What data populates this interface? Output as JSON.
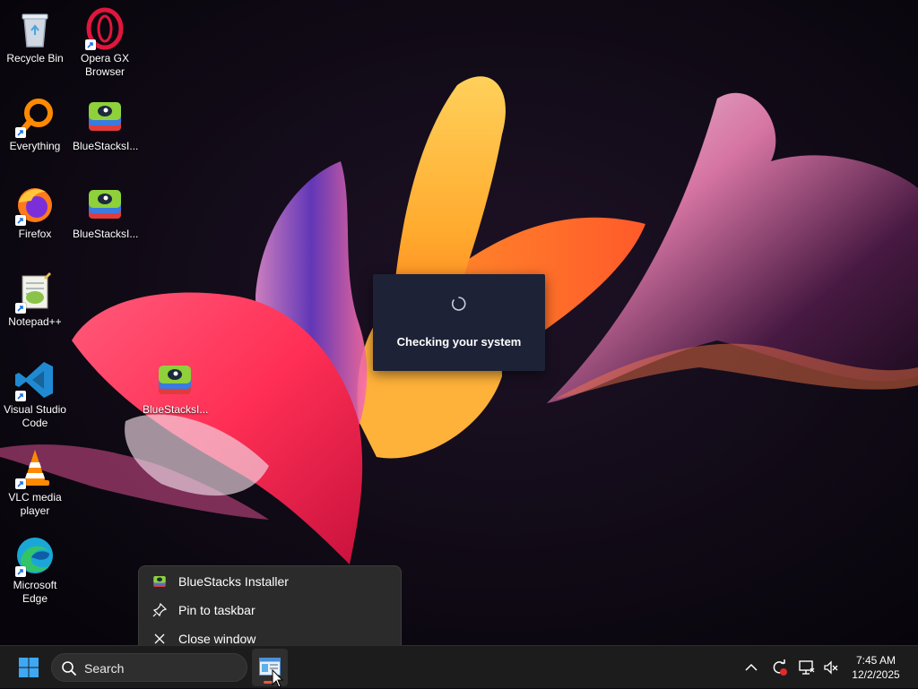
{
  "desktop": {
    "icons": [
      {
        "label": "Recycle Bin"
      },
      {
        "label": "Opera GX Browser"
      },
      {
        "label": "Everything"
      },
      {
        "label": "BlueStacksI..."
      },
      {
        "label": "Firefox"
      },
      {
        "label": "BlueStacksI..."
      },
      {
        "label": "Notepad++"
      },
      {
        "label": "Visual Studio Code"
      },
      {
        "label": "VLC media player"
      },
      {
        "label": "Microsoft Edge"
      },
      {
        "label": "BlueStacksI..."
      }
    ]
  },
  "dialog": {
    "message": "Checking your system"
  },
  "jump_list": {
    "items": [
      {
        "label": "BlueStacks Installer",
        "icon": "bluestacks-icon"
      },
      {
        "label": "Pin to taskbar",
        "icon": "pin-icon"
      },
      {
        "label": "Close window",
        "icon": "close-icon"
      }
    ]
  },
  "taskbar": {
    "search_placeholder": "Search",
    "clock_time": "7:45 AM",
    "clock_date": "12/2/2025",
    "accent_indicator": "#e95a3c"
  }
}
